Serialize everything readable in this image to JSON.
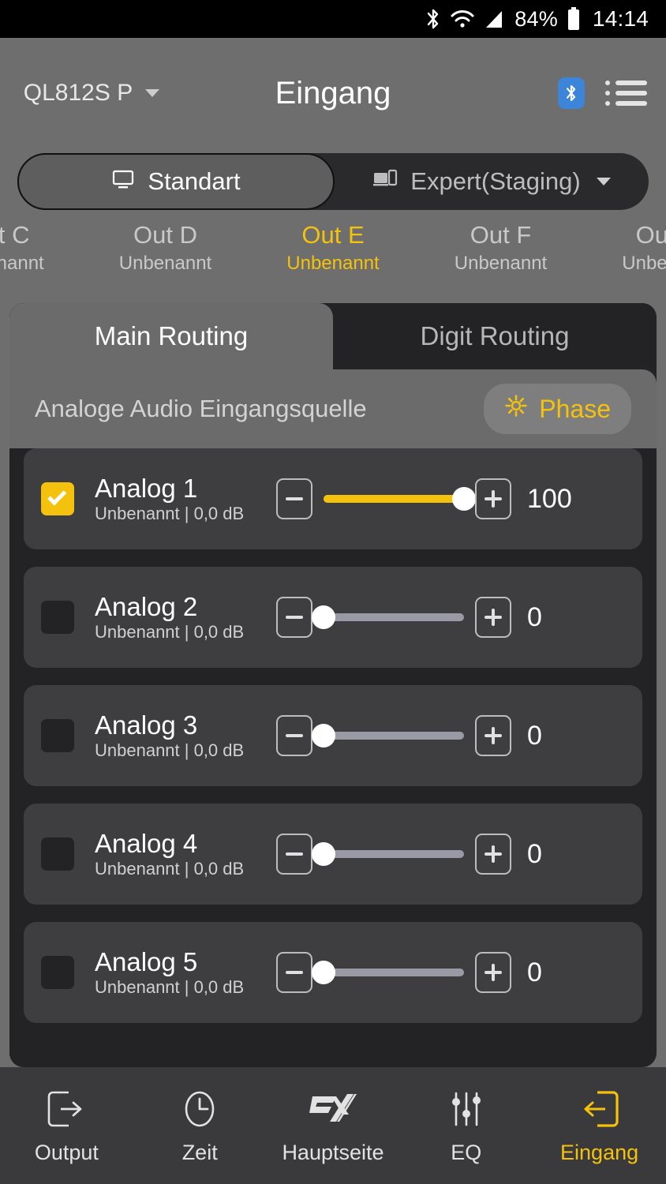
{
  "statusbar": {
    "battery_pct": "84%",
    "time": "14:14",
    "icons": [
      "bluetooth-icon",
      "wifi-icon",
      "cellular-signal-icon",
      "battery-icon"
    ]
  },
  "header": {
    "device_name": "QL812S P",
    "title": "Eingang",
    "bluetooth_badge": "bluetooth-icon",
    "menu_icon": "list-menu-icon"
  },
  "mode_selector": {
    "options": [
      {
        "label": "Standart",
        "icon": "monitor-icon",
        "selected": true
      },
      {
        "label": "Expert(Staging)",
        "icon": "devices-icon",
        "selected": false
      }
    ]
  },
  "channels": [
    {
      "name": "Out C",
      "sub": "Unbenannt",
      "selected": false
    },
    {
      "name": "Out D",
      "sub": "Unbenannt",
      "selected": false
    },
    {
      "name": "Out E",
      "sub": "Unbenannt",
      "selected": true
    },
    {
      "name": "Out F",
      "sub": "Unbenannt",
      "selected": false
    },
    {
      "name": "Out G",
      "sub": "Unbenannt",
      "selected": false
    }
  ],
  "routing_tabs": [
    {
      "label": "Main Routing",
      "active": true
    },
    {
      "label": "Digit Routing",
      "active": false
    }
  ],
  "panel": {
    "section_title": "Analoge Audio Eingangsquelle",
    "phase_button": {
      "label": "Phase",
      "icon": "gear-icon"
    }
  },
  "input_rows": [
    {
      "name": "Analog 1",
      "sub": "Unbenannt  |  0,0 dB",
      "checked": true,
      "value": "100",
      "percent": 100
    },
    {
      "name": "Analog 2",
      "sub": "Unbenannt  |  0,0 dB",
      "checked": false,
      "value": "0",
      "percent": 0
    },
    {
      "name": "Analog 3",
      "sub": "Unbenannt  |  0,0 dB",
      "checked": false,
      "value": "0",
      "percent": 0
    },
    {
      "name": "Analog 4",
      "sub": "Unbenannt  |  0,0 dB",
      "checked": false,
      "value": "0",
      "percent": 0
    },
    {
      "name": "Analog 5",
      "sub": "Unbenannt  |  0,0 dB",
      "checked": false,
      "value": "0",
      "percent": 0
    }
  ],
  "bottom_nav": [
    {
      "label": "Output",
      "icon": "arrow-out-box-icon",
      "active": false
    },
    {
      "label": "Zeit",
      "icon": "clock-icon",
      "active": false
    },
    {
      "label": "Hauptseite",
      "icon": "esx-logo-icon",
      "active": false
    },
    {
      "label": "EQ",
      "icon": "equalizer-icon",
      "active": false
    },
    {
      "label": "Eingang",
      "icon": "arrow-in-box-icon",
      "active": true
    }
  ],
  "colors": {
    "accent": "#f4c20d",
    "bluetooth": "#3d85d8",
    "panel_bg": "#6b6b6b",
    "card_bg": "#232326",
    "row_bg": "#3e3e40"
  }
}
